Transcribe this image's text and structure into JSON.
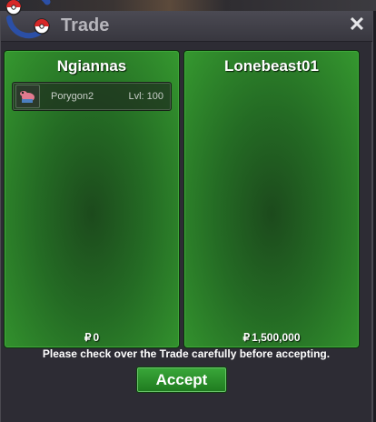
{
  "window": {
    "title": "Trade",
    "close_glyph": "✕"
  },
  "left_panel": {
    "player_name": "Ngiannas",
    "items": [
      {
        "pokemon": "Porygon2",
        "level": "Lvl: 100",
        "icon": "porygon2-icon"
      }
    ],
    "currency_symbol": "₽",
    "money": "0"
  },
  "right_panel": {
    "player_name": "Lonebeast01",
    "items": [],
    "currency_symbol": "₽",
    "money": "1,500,000"
  },
  "footer": {
    "notice": "Please check over the Trade carefully before accepting.",
    "accept_label": "Accept"
  },
  "colors": {
    "panel_green": "#246b24",
    "accept_green": "#2a8f2a",
    "window_bg": "#2d2c34"
  }
}
